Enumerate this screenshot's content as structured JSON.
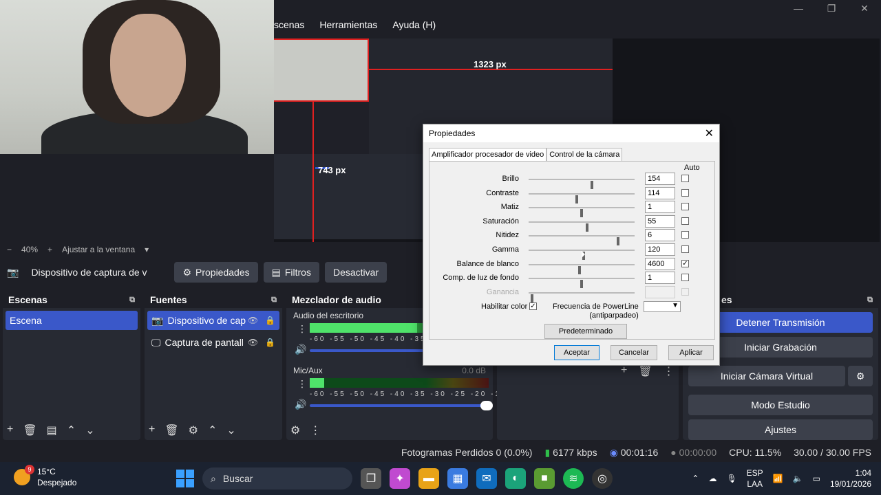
{
  "menu": [
    "scenas",
    "Herramientas",
    "Ayuda (H)"
  ],
  "window_controls": [
    "—",
    "❐",
    "✕"
  ],
  "preview": {
    "measure_width": "1323 px",
    "measure_height": "743 px"
  },
  "zoom": {
    "minus": "−",
    "value": "40%",
    "plus": "+",
    "fit": "Ajustar a la ventana"
  },
  "source_bar": {
    "title": "Dispositivo de captura de v",
    "properties": "Propiedades",
    "filters": "Filtros",
    "deactivate": "Desactivar"
  },
  "scenes": {
    "title": "Escenas",
    "items": [
      "Escena"
    ]
  },
  "sources": {
    "title": "Fuentes",
    "items": [
      "Dispositivo de cap",
      "Captura de pantall"
    ]
  },
  "mixer": {
    "title": "Mezclador de audio",
    "channels": [
      {
        "name": "Audio del escritorio",
        "level": 0.6,
        "db": ""
      },
      {
        "name": "Mic/Aux",
        "level": 0.08,
        "db": "0.0 dB"
      }
    ],
    "scale": "-60 -55 -50 -45 -40 -35 -30 -25 -20 -15 -10 -5 0"
  },
  "controls": {
    "title": "es",
    "buttons": [
      "Detener Transmisión",
      "Iniciar Grabación",
      "Iniciar Cámara Virtual",
      "Modo Estudio",
      "Ajustes"
    ]
  },
  "status": {
    "dropped": "Fotogramas Perdidos 0 (0.0%)",
    "bitrate": "6177 kbps",
    "stream_time": "00:01:16",
    "rec_time": "00:00:00",
    "cpu": "CPU: 11.5%",
    "fps": "30.00 / 30.00 FPS"
  },
  "taskbar": {
    "temp": "15°C",
    "weather": "Despejado",
    "badge": "9",
    "search": "Buscar",
    "lang1": "ESP",
    "lang2": "LAA",
    "time": "1:04",
    "date": "19/01/2026"
  },
  "dialog": {
    "title": "Propiedades",
    "tabs": [
      "Amplificador procesador de video",
      "Control de la cámara"
    ],
    "auto_label": "Auto",
    "properties": [
      {
        "label": "Brillo",
        "value": "154",
        "pos": 0.6,
        "auto": false
      },
      {
        "label": "Contraste",
        "value": "114",
        "pos": 0.45,
        "auto": false
      },
      {
        "label": "Matiz",
        "value": "1",
        "pos": 0.5,
        "auto": false
      },
      {
        "label": "Saturación",
        "value": "55",
        "pos": 0.55,
        "auto": false
      },
      {
        "label": "Nitidez",
        "value": "6",
        "pos": 0.85,
        "auto": false
      },
      {
        "label": "Gamma",
        "value": "120",
        "pos": 0.52,
        "auto": false
      },
      {
        "label": "Balance de blanco",
        "value": "4600",
        "pos": 0.48,
        "auto": true
      },
      {
        "label": "Comp. de luz de fondo",
        "value": "1",
        "pos": 0.5,
        "auto": false
      },
      {
        "label": "Ganancia",
        "value": "",
        "pos": 0.02,
        "auto": false,
        "disabled": true
      }
    ],
    "enable_color": "Habilitar color",
    "powerline": "Frecuencia de PowerLine",
    "powerline2": "(antiparpadeo)",
    "default_btn": "Predeterminado",
    "ok": "Aceptar",
    "cancel": "Cancelar",
    "apply": "Aplicar"
  }
}
